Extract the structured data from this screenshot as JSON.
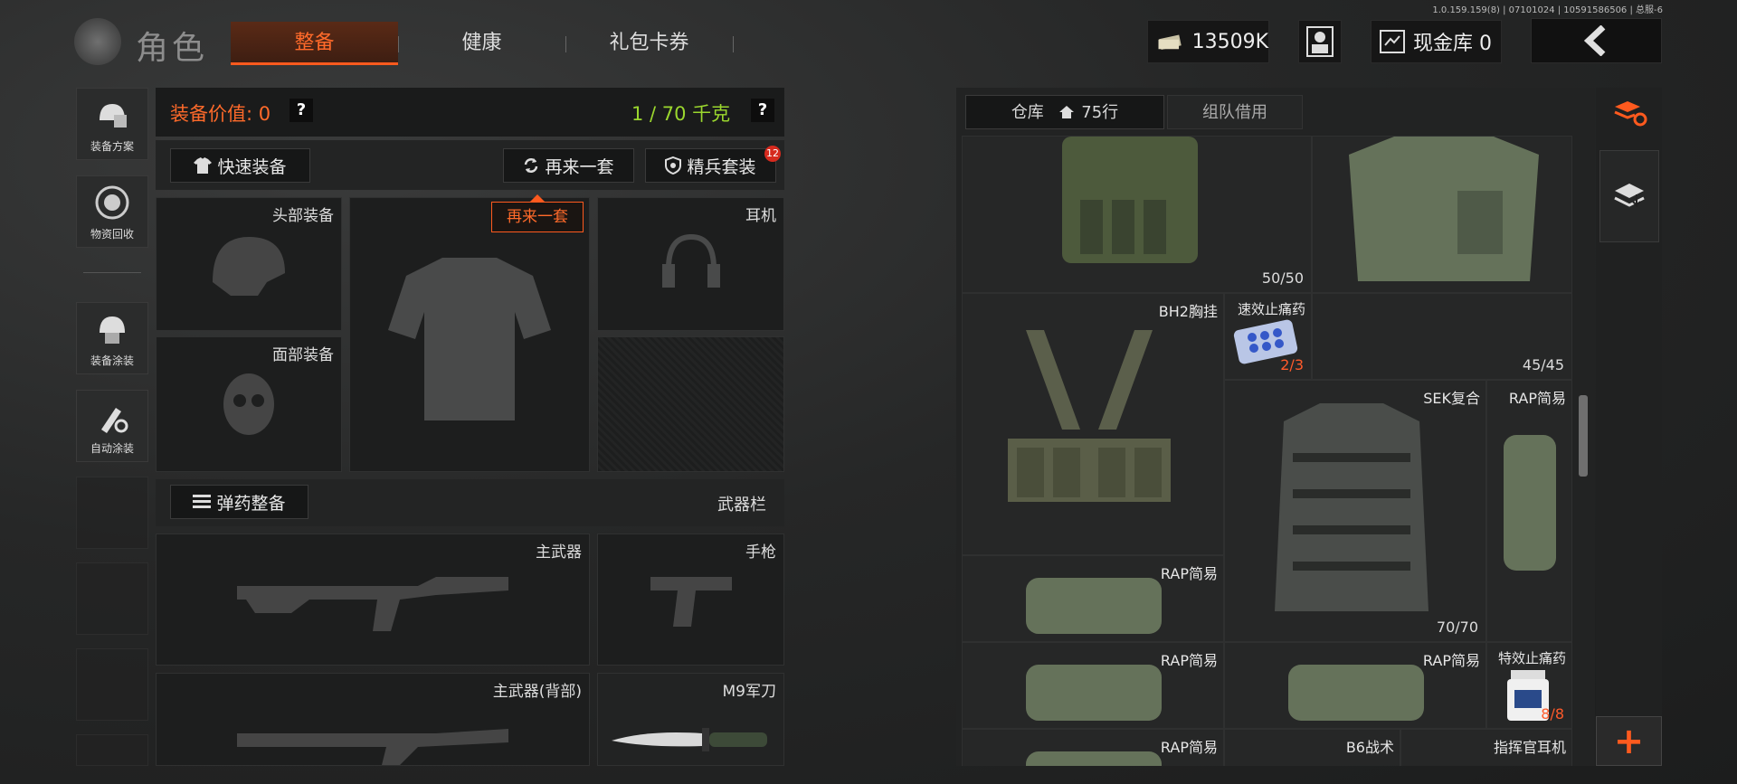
{
  "version": "1.0.159.159(8) | 07101024 | 10591586506 | 总服-6",
  "header": {
    "title": "角色",
    "tabs": [
      {
        "label": "整备",
        "active": true
      },
      {
        "label": "健康",
        "active": false
      },
      {
        "label": "礼包卡券",
        "active": false
      }
    ],
    "currency": "13509K",
    "cash_vault": "现金库 0"
  },
  "sidebar": {
    "items": [
      {
        "label": "装备方案",
        "icon": "loadout-icon"
      },
      {
        "label": "物资回收",
        "icon": "recycle-icon"
      },
      {
        "label": "装备涂装",
        "icon": "skin-icon"
      },
      {
        "label": "自动涂装",
        "icon": "auto-paint-icon"
      }
    ]
  },
  "equipment": {
    "value_label": "装备价值: 0",
    "weight": "1 / 70 千克",
    "help": "?",
    "quick_equip": "快速装备",
    "again": "再来一套",
    "elite": "精兵套装",
    "elite_badge": "12",
    "tooltip": "再来一套",
    "slots": {
      "head": "头部装备",
      "face": "面部装备",
      "earphone": "耳机",
      "weapon_bar": "武器栏",
      "ammo": "弹药整备",
      "primary": "主武器",
      "pistol": "手枪",
      "primary_back": "主武器(背部)",
      "knife": "M9军刀"
    }
  },
  "storage": {
    "tabs": [
      {
        "label": "仓库",
        "extra": "75行",
        "active": true
      },
      {
        "label": "组队借用",
        "active": false
      }
    ],
    "items": [
      {
        "name": "",
        "count": "50/50"
      },
      {
        "name": "",
        "count": "45/45"
      },
      {
        "name": "BH2胸挂",
        "count": ""
      },
      {
        "name": "速效止痛药",
        "count": "2/3"
      },
      {
        "name": "SEK复合",
        "count": "70/70"
      },
      {
        "name": "RAP简易",
        "count": ""
      },
      {
        "name": "RAP简易",
        "count": ""
      },
      {
        "name": "RAP简易",
        "count": ""
      },
      {
        "name": "RAP简易",
        "count": ""
      },
      {
        "name": "特效止痛药",
        "count": "8/8"
      },
      {
        "name": "RAP简易",
        "count": ""
      },
      {
        "name": "B6战术",
        "count": ""
      },
      {
        "name": "指挥官耳机",
        "count": ""
      }
    ],
    "add": "+"
  }
}
